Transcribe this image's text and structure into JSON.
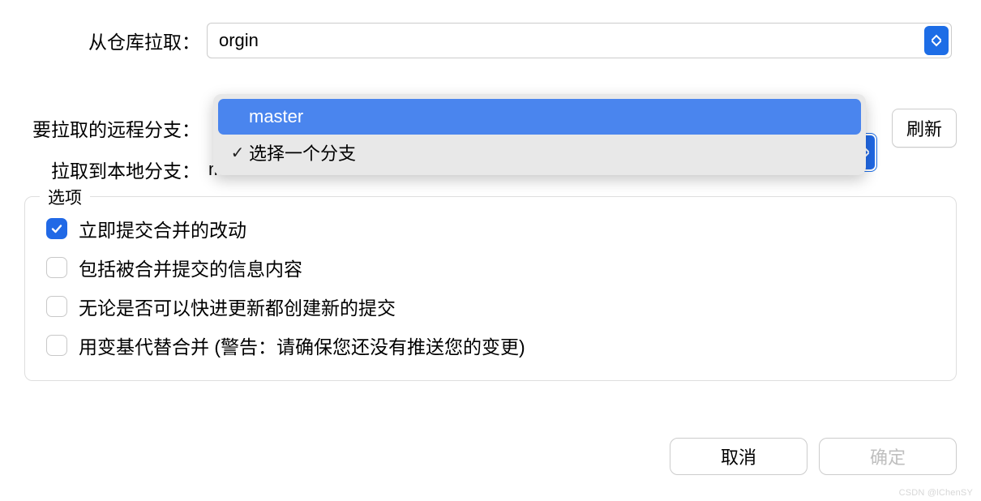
{
  "repo_row": {
    "label": "从仓库拉取：",
    "value": "orgin"
  },
  "remote_branch_row": {
    "label": "要拉取的远程分支：",
    "placeholder": "选择一个分支",
    "refresh_label": "刷新"
  },
  "local_branch_row": {
    "label": "拉取到本地分支：",
    "value": "master"
  },
  "dropdown": {
    "items": [
      {
        "label": "master",
        "checked": false,
        "highlighted": true
      },
      {
        "label": "选择一个分支",
        "checked": true,
        "highlighted": false
      }
    ]
  },
  "options": {
    "legend": "选项",
    "items": [
      {
        "label": "立即提交合并的改动",
        "checked": true
      },
      {
        "label": "包括被合并提交的信息内容",
        "checked": false
      },
      {
        "label": "无论是否可以快进更新都创建新的提交",
        "checked": false
      },
      {
        "label": "用变基代替合并 (警告：请确保您还没有推送您的变更)",
        "checked": false
      }
    ]
  },
  "buttons": {
    "cancel": "取消",
    "ok": "确定"
  },
  "watermark": "CSDN @lChenSY"
}
